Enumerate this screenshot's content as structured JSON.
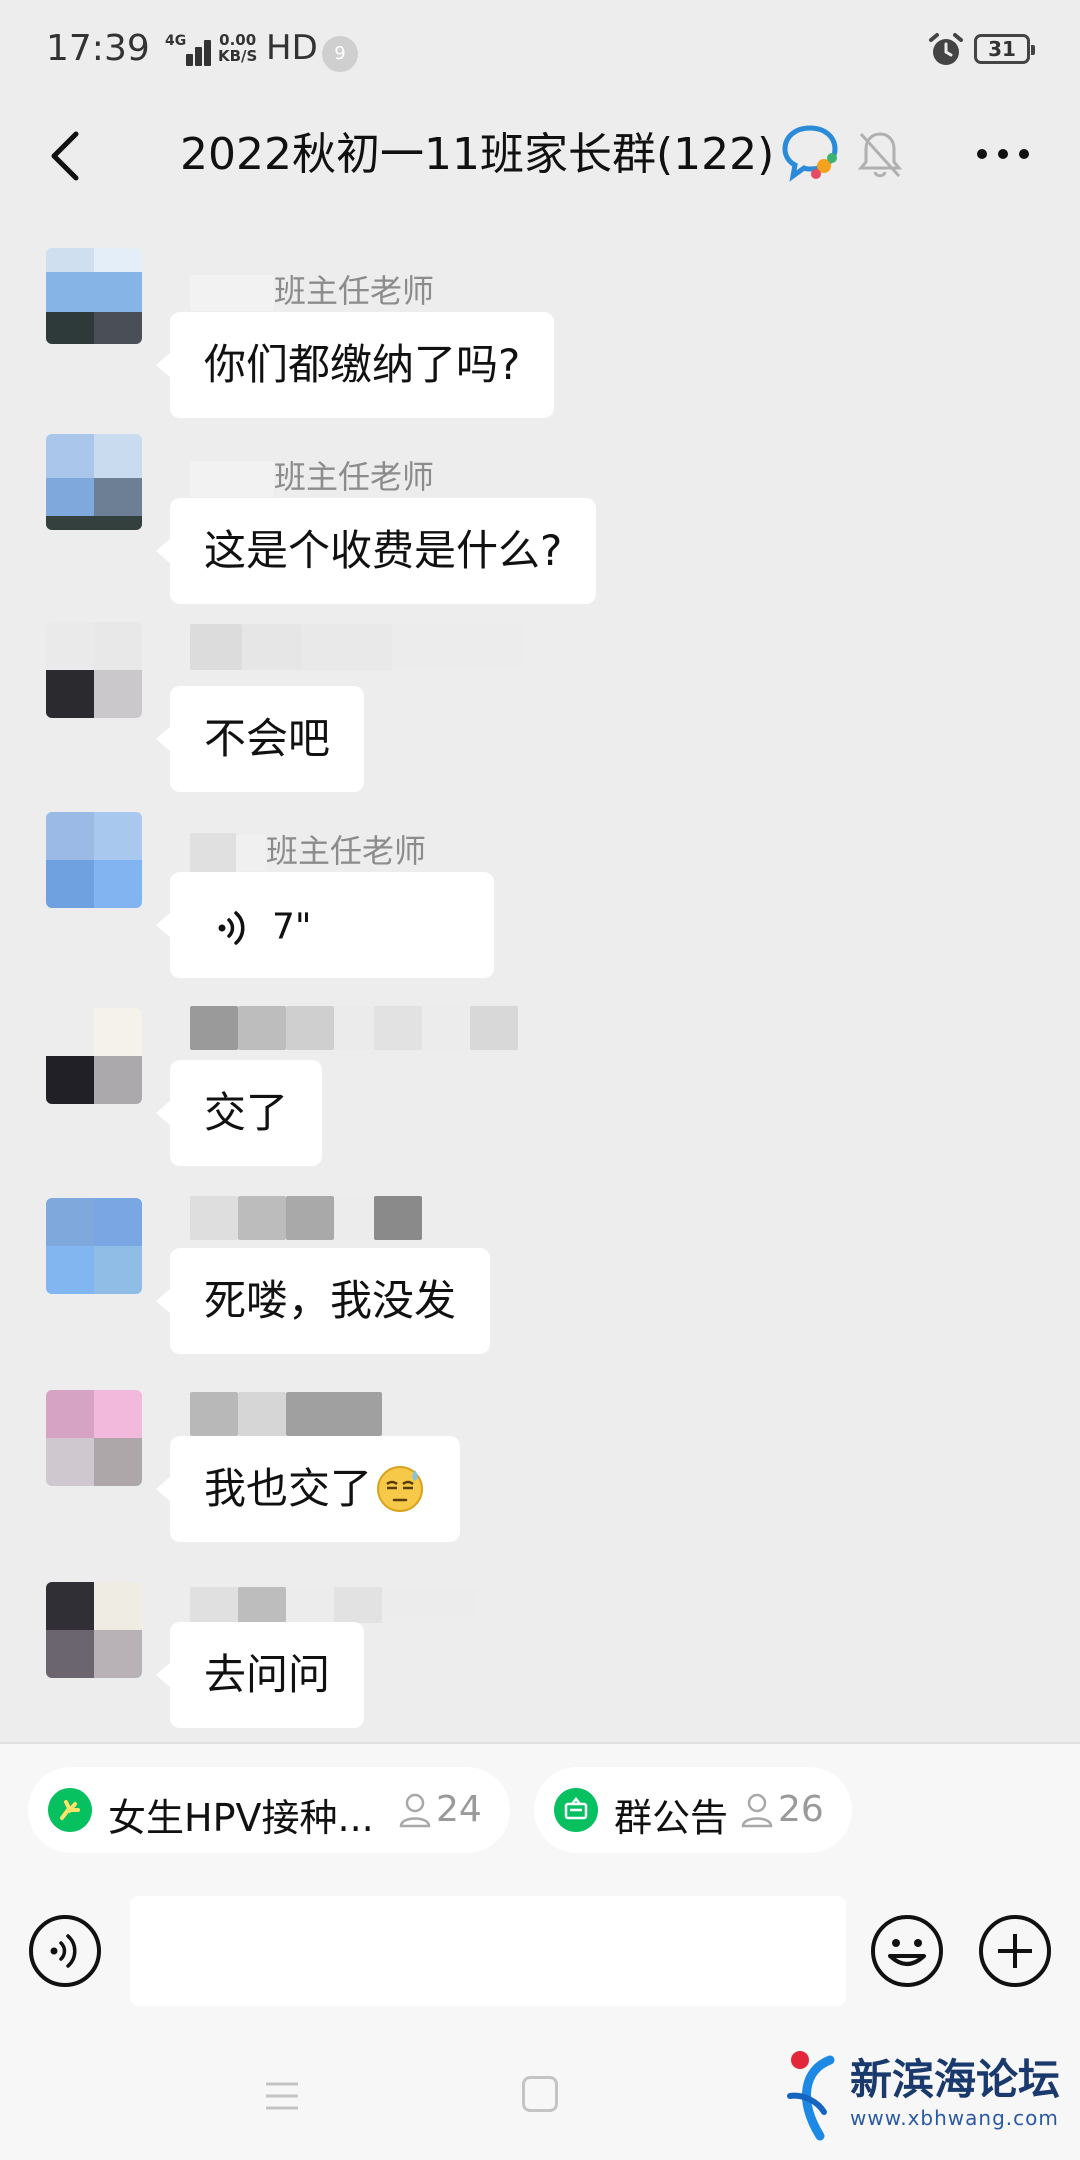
{
  "status_bar": {
    "time": "17:39",
    "network": "4G",
    "speed_value": "0.00",
    "speed_unit": "KB/S",
    "hd": "HD",
    "notification_count": "9",
    "battery": "31"
  },
  "header": {
    "title": "2022秋初一11班家长群(122)"
  },
  "messages": [
    {
      "sender": "班主任老师",
      "text": "你们都缴纳了吗?"
    },
    {
      "sender": "班主任老师",
      "text": "这是个收费是什么?"
    },
    {
      "sender": "",
      "text": "不会吧"
    },
    {
      "sender": "班主任老师",
      "voice_duration": "7\""
    },
    {
      "sender": "",
      "text": "交了"
    },
    {
      "sender": "",
      "text": "死喽，我没发"
    },
    {
      "sender": "",
      "text": "我也交了"
    },
    {
      "sender": "",
      "text": "去问问"
    }
  ],
  "pinned": [
    {
      "label": "女生HPV接种...",
      "count": "24"
    },
    {
      "label": "群公告",
      "count": "26"
    }
  ],
  "watermark": {
    "name": "新滨海论坛",
    "url": "www.xbhwang.com"
  },
  "colors": {
    "background": "#ededed",
    "bubble": "#ffffff",
    "accent_green": "#07c160",
    "sender_gray": "#8c8c8c"
  },
  "icons": [
    "back-arrow-icon",
    "group-chat-badge-icon",
    "mute-bell-icon",
    "more-dots-icon",
    "voice-icon",
    "emoji-icon",
    "plus-icon",
    "user-icon",
    "alarm-icon",
    "battery-icon"
  ]
}
